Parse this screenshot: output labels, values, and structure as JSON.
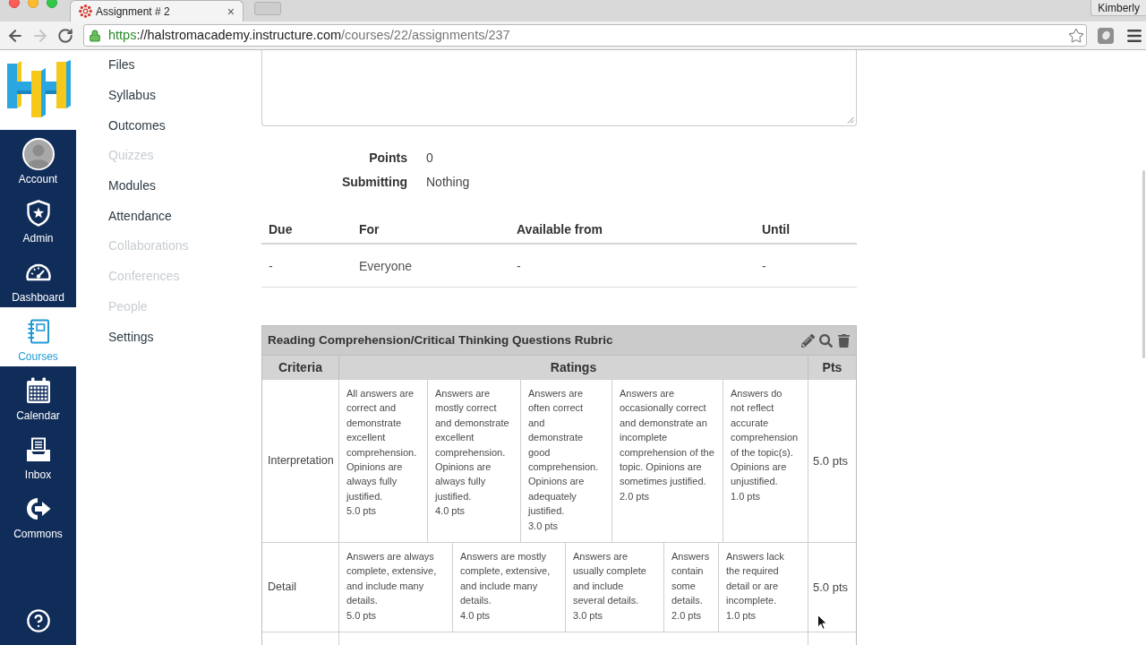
{
  "browser": {
    "tab_title": "Assignment # 2",
    "tab_close": "×",
    "profile": "Kimberly",
    "nav_buttons": [
      {
        "kind": "back",
        "disabled": false
      },
      {
        "kind": "forward",
        "disabled": true
      },
      {
        "kind": "reload",
        "disabled": false
      }
    ],
    "address": {
      "scheme": "https",
      "host": "://halstromacademy.instructure.com",
      "path": "/courses/22/assignments/237"
    }
  },
  "global_nav": [
    {
      "kind": "account",
      "label": "Account",
      "selected": false
    },
    {
      "kind": "admin",
      "label": "Admin",
      "selected": false
    },
    {
      "kind": "dashboard",
      "label": "Dashboard",
      "selected": false
    },
    {
      "kind": "courses",
      "label": "Courses",
      "selected": true
    },
    {
      "kind": "calendar",
      "label": "Calendar",
      "selected": false
    },
    {
      "kind": "inbox",
      "label": "Inbox",
      "selected": false
    },
    {
      "kind": "commons",
      "label": "Commons",
      "selected": false
    }
  ],
  "course_nav": [
    {
      "label": "Files",
      "disabled": false
    },
    {
      "label": "Syllabus",
      "disabled": false
    },
    {
      "label": "Outcomes",
      "disabled": false
    },
    {
      "label": "Quizzes",
      "disabled": true
    },
    {
      "label": "Modules",
      "disabled": false
    },
    {
      "label": "Attendance",
      "disabled": false
    },
    {
      "label": "Collaborations",
      "disabled": true
    },
    {
      "label": "Conferences",
      "disabled": true
    },
    {
      "label": "People",
      "disabled": true
    },
    {
      "label": "Settings",
      "disabled": false
    }
  ],
  "details": [
    {
      "label": "Points",
      "value": "0"
    },
    {
      "label": "Submitting",
      "value": "Nothing"
    }
  ],
  "dates_table": {
    "columns": [
      "Due",
      "For",
      "Available from",
      "Until"
    ],
    "rows": [
      [
        "-",
        "Everyone",
        "-",
        "-"
      ]
    ]
  },
  "rubric": {
    "title": "Reading Comprehension/Critical Thinking Questions Rubric",
    "columns": [
      "Criteria",
      "Ratings",
      "Pts"
    ],
    "rows": [
      {
        "criterion": "Interpretation",
        "ratings": [
          {
            "description": "All answers are correct and demonstrate excellent comprehension. Opinions are always fully justified.",
            "points": "5.0 pts"
          },
          {
            "description": "Answers are mostly correct and demonstrate excellent comprehension. Opinions are always fully justified.",
            "points": "4.0 pts"
          },
          {
            "description": "Answers are often correct and demonstrate good comprehension. Opinions are adequately justified.",
            "points": "3.0 pts"
          },
          {
            "description": "Answers are occasionally correct and demonstrate an incomplete comprehension of the topic. Opinions are sometimes justified.",
            "points": "2.0 pts"
          },
          {
            "description": "Answers do not reflect accurate comprehension of the topic(s). Opinions are unjustified.",
            "points": "1.0 pts"
          }
        ],
        "points": "5.0 pts"
      },
      {
        "criterion": "Detail",
        "ratings": [
          {
            "description": "Answers are always complete, extensive, and include many details.",
            "points": "5.0 pts"
          },
          {
            "description": "Answers are mostly complete, extensive, and include many details.",
            "points": "4.0 pts"
          },
          {
            "description": "Answers are usually complete and include several details.",
            "points": "3.0 pts"
          },
          {
            "description": "Answers contain some details.",
            "points": "2.0 pts"
          },
          {
            "description": "Answers lack the required detail or are incomplete.",
            "points": "1.0 pts"
          }
        ],
        "points": "5.0 pts"
      }
    ]
  }
}
